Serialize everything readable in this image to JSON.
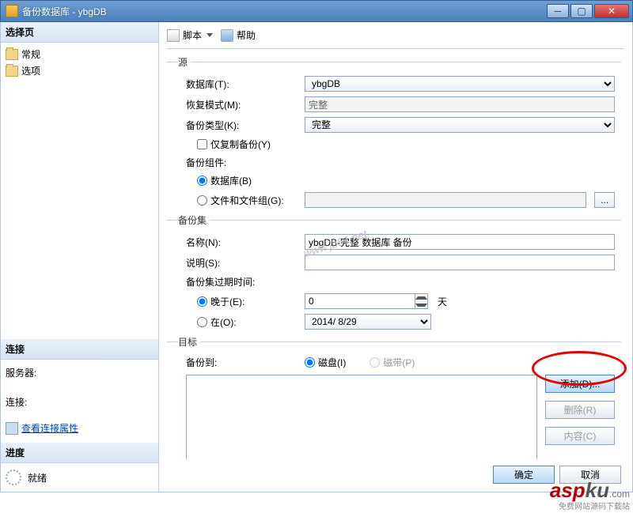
{
  "window": {
    "title": "备份数据库 - ybgDB"
  },
  "sidebar": {
    "select_header": "选择页",
    "pages": [
      "常规",
      "选项"
    ],
    "conn_header": "连接",
    "server_label": "服务器:",
    "server_value": "",
    "conn_label": "连接:",
    "conn_value": "",
    "view_conn_props": "查看连接属性",
    "progress_header": "进度",
    "progress_status": "就绪"
  },
  "toolbar": {
    "script": "脚本",
    "help": "帮助"
  },
  "source": {
    "legend": "源",
    "db_label": "数据库(T):",
    "db_value": "ybgDB",
    "rm_label": "恢复模式(M):",
    "rm_value": "完整",
    "bt_label": "备份类型(K):",
    "bt_value": "完整",
    "copy_only": "仅复制备份(Y)",
    "comp_label": "备份组件:",
    "comp_db": "数据库(B)",
    "comp_fg": "文件和文件组(G):"
  },
  "set": {
    "legend": "备份集",
    "name_label": "名称(N):",
    "name_value": "ybgDB-完整 数据库 备份",
    "desc_label": "说明(S):",
    "desc_value": "",
    "expire_label": "备份集过期时间:",
    "after_label": "晚于(E):",
    "after_value": "0",
    "after_unit": "天",
    "on_label": "在(O):",
    "on_value": "2014/ 8/29"
  },
  "dest": {
    "legend": "目标",
    "to_label": "备份到:",
    "disk": "磁盘(I)",
    "tape": "磁带(P)",
    "add": "添加(D)...",
    "remove": "删除(R)",
    "contents": "内容(C)"
  },
  "footer": {
    "ok": "确定",
    "cancel": "取消"
  },
  "watermark": {
    "url": "www.jb51.net",
    "brand_a": "asp",
    "brand_b": "ku",
    "tag": "免费网站源码下载站"
  }
}
